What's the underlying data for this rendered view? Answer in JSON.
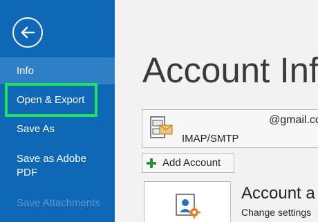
{
  "sidebar": {
    "back_label": "Back",
    "items": [
      {
        "label": "Info"
      },
      {
        "label": "Open & Export"
      },
      {
        "label": "Save As"
      },
      {
        "label": "Save as Adobe PDF"
      },
      {
        "label": "Save Attachments"
      }
    ]
  },
  "main": {
    "title": "Account Inf",
    "account": {
      "email": "@gmail.co",
      "type": "IMAP/SMTP"
    },
    "add_account_label": "Add Account",
    "settings": {
      "title": "Account a",
      "description": "Change settings"
    }
  },
  "colors": {
    "sidebar_bg": "#0f67b8",
    "active_item_bg": "#2f7fc6",
    "highlight_border": "#1ee35a",
    "main_bg": "#f2f2f2"
  },
  "icons": [
    "back-arrow-icon",
    "email-account-icon",
    "plus-icon",
    "account-settings-icon"
  ]
}
